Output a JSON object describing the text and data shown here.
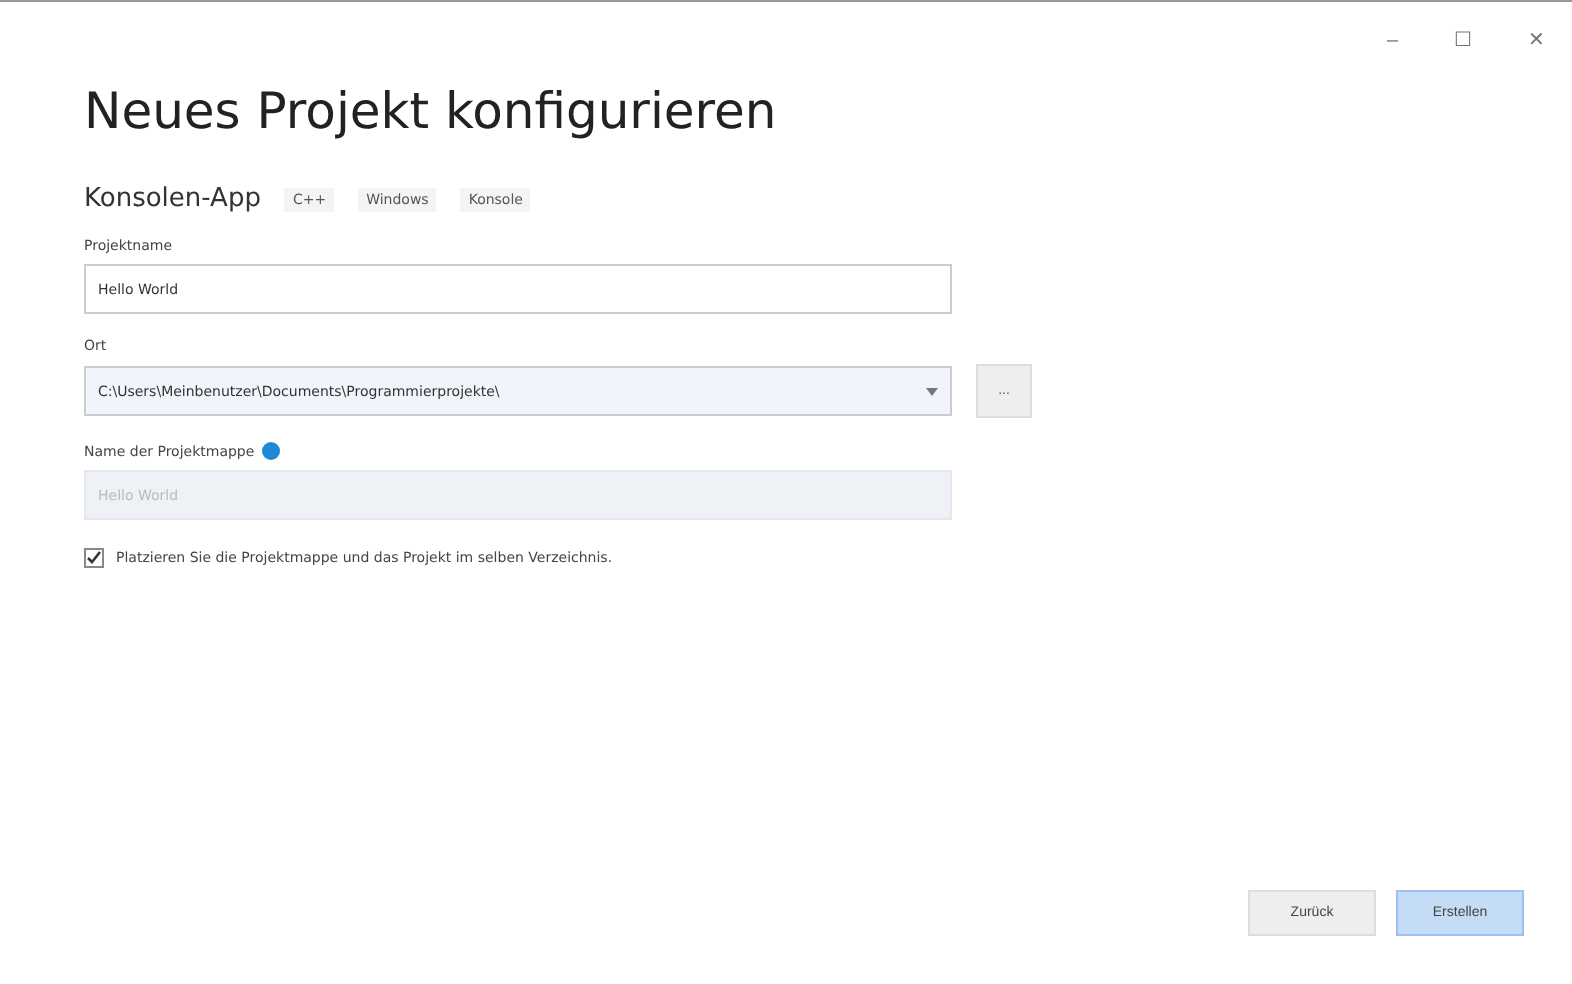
{
  "window": {
    "controls": [
      "–",
      "☐",
      "✕"
    ]
  },
  "title": "Neues Projekt konfigurieren",
  "template": {
    "name": "Konsolen-App",
    "tags": [
      "C++",
      "Windows",
      "Konsole"
    ]
  },
  "fields": [
    {
      "kind": "text",
      "label": "Projektname",
      "value": "Hello World",
      "disabled": false
    },
    {
      "kind": "combo",
      "label": "Ort",
      "value": "C:\\Users\\Meinbenutzer\\Documents\\Programmierprojekte\\",
      "browse": "..."
    },
    {
      "kind": "text",
      "label": "Name der Projektmappe",
      "info": true,
      "value": "Hello World",
      "disabled": true
    }
  ],
  "same_directory": {
    "label": "Platzieren Sie die Projektmappe und das Projekt im selben Verzeichnis.",
    "checked": true
  },
  "buttons": [
    {
      "label": "Zurück",
      "primary": false
    },
    {
      "label": "Erstellen",
      "primary": true
    }
  ]
}
